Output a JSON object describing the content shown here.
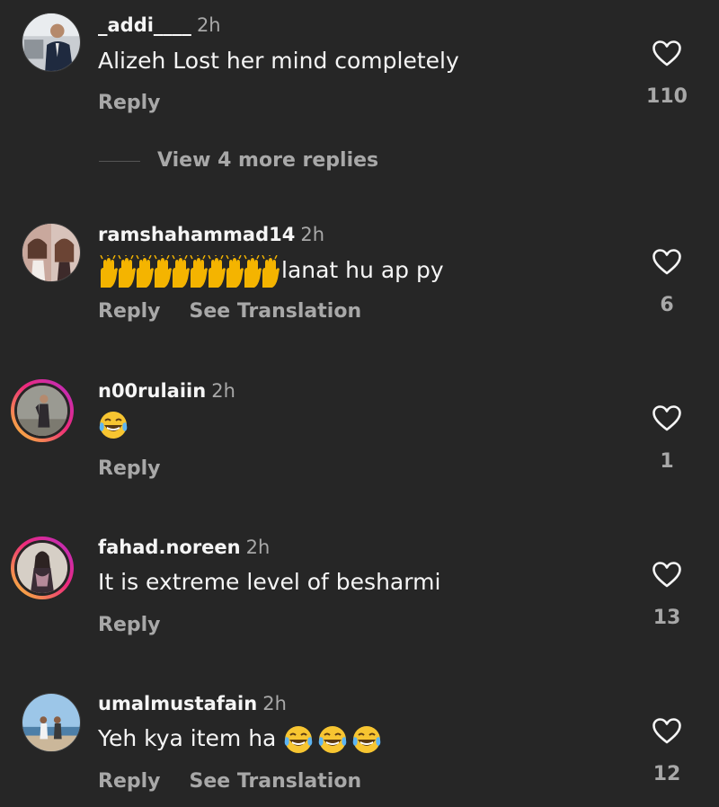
{
  "comments": [
    {
      "username": "_addi____",
      "time": "2h",
      "text": "Alizeh Lost her mind completely",
      "actions": [
        "Reply"
      ],
      "likes": "110",
      "view_more": "View 4 more replies"
    },
    {
      "username": "ramshahammad14",
      "time": "2h",
      "text": "lanat hu ap py",
      "actions": [
        "Reply",
        "See Translation"
      ],
      "likes": "6"
    },
    {
      "username": "n00rulaiin",
      "time": "2h",
      "text": "",
      "actions": [
        "Reply"
      ],
      "likes": "1"
    },
    {
      "username": "fahad.noreen",
      "time": "2h",
      "text": "It is extreme level of besharmi",
      "actions": [
        "Reply"
      ],
      "likes": "13"
    },
    {
      "username": "umalmustafain",
      "time": "2h",
      "text": "Yeh kya item ha",
      "actions": [
        "Reply",
        "See Translation"
      ],
      "likes": "12"
    }
  ],
  "icons": {
    "like": "heart-outline-icon",
    "emoji_laugh": "face-with-tears-of-joy-icon",
    "emoji_hands": "raising-hands-icon"
  },
  "colors": {
    "background": "#262626",
    "text_primary": "#f5f5f5",
    "text_secondary": "#a8a8a8"
  }
}
